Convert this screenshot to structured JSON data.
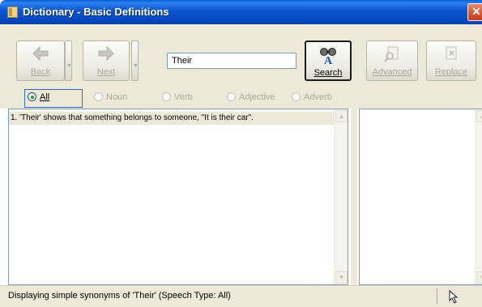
{
  "window": {
    "title": "Dictionary - Basic Definitions",
    "close_glyph": "✕"
  },
  "toolbar": {
    "back_label": "Back",
    "next_label": "Next",
    "search_value": "Their",
    "search_button_label": "Search",
    "advanced_label": "Advanced",
    "replace_label": "Replace"
  },
  "speech_types": {
    "selected": "All",
    "options": [
      {
        "label": "All",
        "selected": true
      },
      {
        "label": "Noun",
        "selected": false
      },
      {
        "label": "Verb",
        "selected": false
      },
      {
        "label": "Adjective",
        "selected": false
      },
      {
        "label": "Adverb",
        "selected": false
      }
    ]
  },
  "results": {
    "entries": [
      "1. 'Their' shows that something belongs to someone, \"It is their car\"."
    ]
  },
  "status": {
    "text": "Displaying simple synonyms of 'Their' (Speech Type: All)"
  },
  "icons": {
    "back": "left-arrow-icon",
    "next": "right-arrow-icon",
    "search": "binoculars-icon",
    "advanced": "magnifier-doc-icon",
    "replace": "replace-doc-icon",
    "status_cursor": "resize-cursor-icon"
  },
  "colors": {
    "title_blue": "#0a54d0",
    "close_red": "#d4542f",
    "panel": "#ece9d8",
    "disabled_text": "#aca899",
    "input_border": "#7f9db9"
  }
}
